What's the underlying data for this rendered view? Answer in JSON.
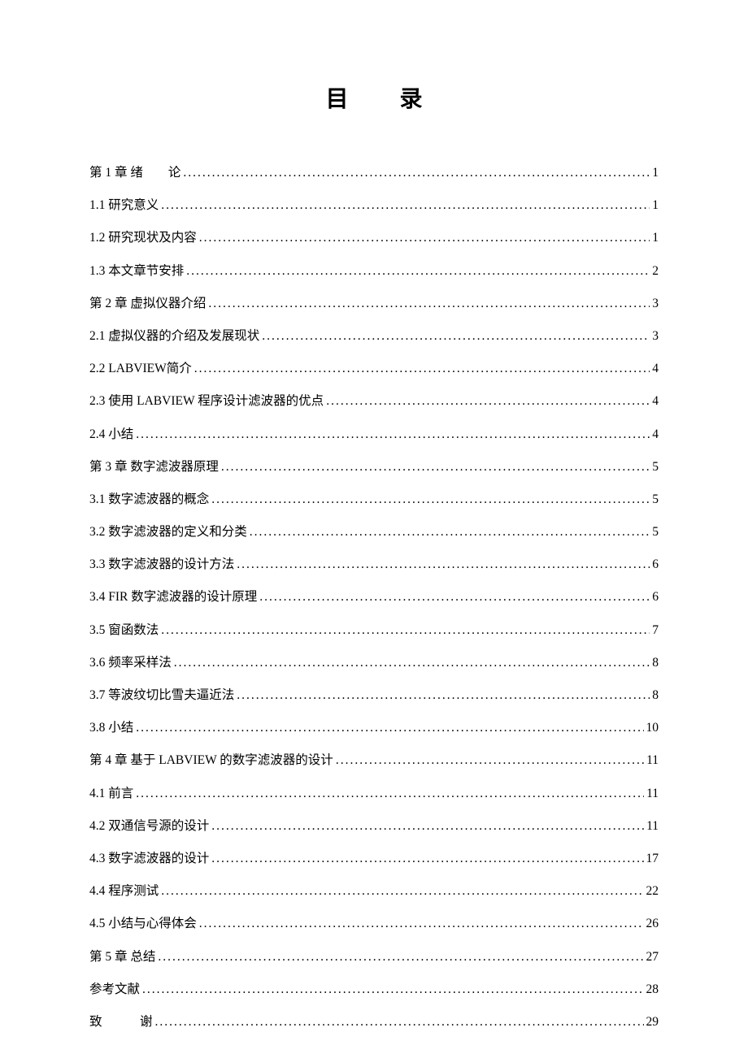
{
  "title_part1": "目",
  "title_part2": "录",
  "toc": [
    {
      "label": "第 1 章 绪　　论",
      "page": "1"
    },
    {
      "label": "1.1 研究意义",
      "page": "1"
    },
    {
      "label": "1.2 研究现状及内容",
      "page": "1"
    },
    {
      "label": "1.3 本文章节安排",
      "page": "2"
    },
    {
      "label": "第 2 章 虚拟仪器介绍",
      "page": "3"
    },
    {
      "label": "2.1 虚拟仪器的介绍及发展现状",
      "page": "3"
    },
    {
      "label": "2.2 LABVIEW简介",
      "page": "4"
    },
    {
      "label": "2.3 使用 LABVIEW 程序设计滤波器的优点",
      "page": "4"
    },
    {
      "label": "2.4 小结",
      "page": "4"
    },
    {
      "label": "第 3 章 数字滤波器原理",
      "page": "5"
    },
    {
      "label": "3.1 数字滤波器的概念",
      "page": "5"
    },
    {
      "label": "3.2 数字滤波器的定义和分类",
      "page": "5"
    },
    {
      "label": "3.3  数字滤波器的设计方法",
      "page": "6"
    },
    {
      "label": "3.4  FIR 数字滤波器的设计原理",
      "page": "6"
    },
    {
      "label": "3.5 窗函数法",
      "page": "7"
    },
    {
      "label": "3.6  频率采样法",
      "page": "8"
    },
    {
      "label": "3.7 等波纹切比雪夫逼近法",
      "page": "8"
    },
    {
      "label": "3.8 小结",
      "page": "10"
    },
    {
      "label": "第 4 章 基于 LABVIEW 的数字滤波器的设计",
      "page": "11"
    },
    {
      "label": "4.1 前言",
      "page": "11"
    },
    {
      "label": "4.2 双通信号源的设计",
      "page": "11"
    },
    {
      "label": "4.3 数字滤波器的设计",
      "page": "17"
    },
    {
      "label": "4.4 程序测试",
      "page": "22"
    },
    {
      "label": "4.5 小结与心得体会",
      "page": "26"
    },
    {
      "label": "第 5 章 总结",
      "page": "27"
    },
    {
      "label": "参考文献",
      "page": "28"
    },
    {
      "label": "致　　　谢",
      "page": "29"
    }
  ]
}
